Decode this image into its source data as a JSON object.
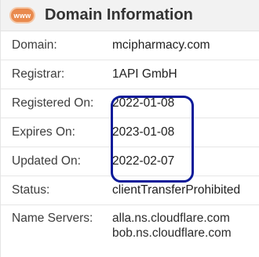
{
  "header": {
    "badge": "www",
    "title": "Domain Information"
  },
  "rows": [
    {
      "label": "Domain:",
      "value": "mcipharmacy.com"
    },
    {
      "label": "Registrar:",
      "value": "1API GmbH"
    },
    {
      "label": "Registered On:",
      "value": "2022-01-08"
    },
    {
      "label": "Expires On:",
      "value": "2023-01-08"
    },
    {
      "label": "Updated On:",
      "value": "2022-02-07"
    },
    {
      "label": "Status:",
      "value": "clientTransferProhibited"
    }
  ],
  "name_servers": {
    "label": "Name Servers:",
    "values": [
      "alla.ns.cloudflare.com",
      "bob.ns.cloudflare.com"
    ]
  },
  "colors": {
    "badge": "#e98a4e",
    "highlight": "#0b1a99",
    "header_bg": "#f2f2f2"
  }
}
